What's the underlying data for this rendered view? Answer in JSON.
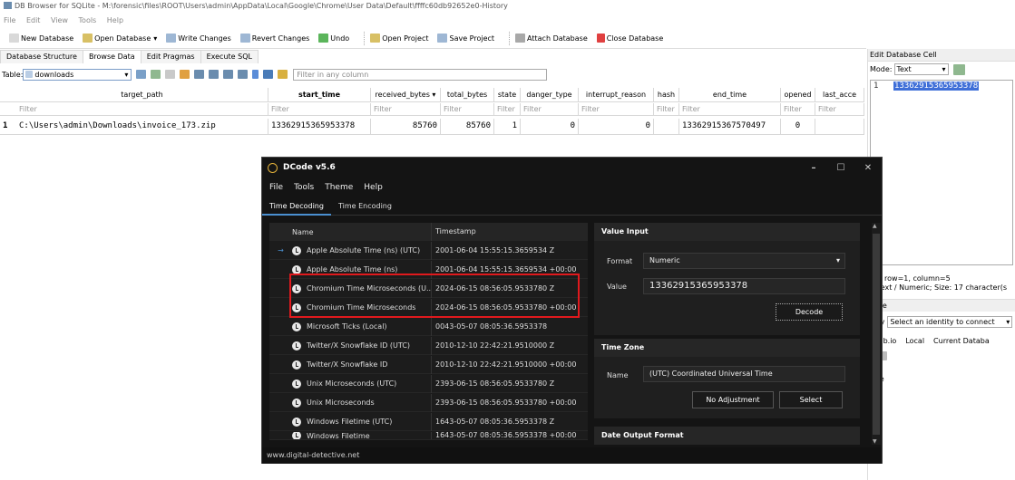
{
  "window": {
    "title": "DB Browser for SQLite - M:\\forensic\\files\\ROOT\\Users\\admin\\AppData\\Local\\Google\\Chrome\\User Data\\Default\\ffffc60db92652e0-History"
  },
  "menu": [
    "File",
    "Edit",
    "View",
    "Tools",
    "Help"
  ],
  "toolbar": {
    "new_db": "New Database",
    "open_db": "Open Database",
    "write": "Write Changes",
    "revert": "Revert Changes",
    "undo": "Undo",
    "open_proj": "Open Project",
    "save_proj": "Save Project",
    "attach": "Attach Database",
    "close_db": "Close Database"
  },
  "tabs": [
    "Database Structure",
    "Browse Data",
    "Edit Pragmas",
    "Execute SQL"
  ],
  "tablebar": {
    "label": "Table:",
    "table": "downloads",
    "filter_placeholder": "Filter in any column"
  },
  "grid": {
    "columns": [
      "target_path",
      "start_time",
      "received_bytes ▾",
      "total_bytes",
      "state",
      "danger_type",
      "interrupt_reason",
      "hash",
      "end_time",
      "opened",
      "last_acce"
    ],
    "filter_label": "Filter",
    "row_number": "1",
    "row": [
      "C:\\Users\\admin\\Downloads\\invoice_173.zip",
      "13362915365953378",
      "85760",
      "85760",
      "1",
      "0",
      "0",
      "",
      "13362915367570497",
      "0",
      ""
    ]
  },
  "editcell": {
    "title": "Edit Database Cell",
    "mode_label": "Mode:",
    "mode": "Text",
    "line": "1",
    "value": "13362915365953378",
    "info1": "ting row=1, column=5",
    "info2": "e: Text / Numeric; Size: 17 character(s",
    "remote": "mote",
    "identity_label": "ntity",
    "identity": "Select an identity to connect",
    "rtabs": [
      "BHub.io",
      "Local",
      "Current Databa"
    ],
    "name_label": "ame"
  },
  "dcode": {
    "title": "DCode v5.6",
    "menu": [
      "File",
      "Tools",
      "Theme",
      "Help"
    ],
    "tabs": [
      "Time Decoding",
      "Time Encoding"
    ],
    "list_head": {
      "name": "Name",
      "timestamp": "Timestamp"
    },
    "rows": [
      {
        "name": "Apple Absolute Time (ns) (UTC)",
        "ts": "2001-06-04 15:55:15.3659534 Z",
        "sel": "→"
      },
      {
        "name": "Apple Absolute Time (ns)",
        "ts": "2001-06-04 15:55:15.3659534 +00:00",
        "sel": ""
      },
      {
        "name": "Chromium Time Microseconds (U...",
        "ts": "2024-06-15 08:56:05.9533780 Z",
        "sel": ""
      },
      {
        "name": "Chromium Time Microseconds",
        "ts": "2024-06-15 08:56:05.9533780 +00:00",
        "sel": ""
      },
      {
        "name": "Microsoft Ticks (Local)",
        "ts": "0043-05-07 08:05:36.5953378",
        "sel": ""
      },
      {
        "name": "Twitter/X Snowflake ID (UTC)",
        "ts": "2010-12-10 22:42:21.9510000 Z",
        "sel": ""
      },
      {
        "name": "Twitter/X Snowflake ID",
        "ts": "2010-12-10 22:42:21.9510000 +00:00",
        "sel": ""
      },
      {
        "name": "Unix Microseconds (UTC)",
        "ts": "2393-06-15 08:56:05.9533780 Z",
        "sel": ""
      },
      {
        "name": "Unix Microseconds",
        "ts": "2393-06-15 08:56:05.9533780 +00:00",
        "sel": ""
      },
      {
        "name": "Windows Filetime (UTC)",
        "ts": "1643-05-07 08:05:36.5953378 Z",
        "sel": ""
      },
      {
        "name": "Windows Filetime",
        "ts": "1643-05-07 08:05:36.5953378 +00:00",
        "sel": ""
      }
    ],
    "value_input": {
      "title": "Value Input",
      "format_label": "Format",
      "format": "Numeric",
      "value_label": "Value",
      "value": "13362915365953378",
      "decode": "Decode"
    },
    "timezone": {
      "title": "Time Zone",
      "name_label": "Name",
      "name": "(UTC) Coordinated Universal Time",
      "noadj": "No Adjustment",
      "select": "Select"
    },
    "date_output": {
      "title": "Date Output Format"
    },
    "footer": "www.digital-detective.net"
  }
}
